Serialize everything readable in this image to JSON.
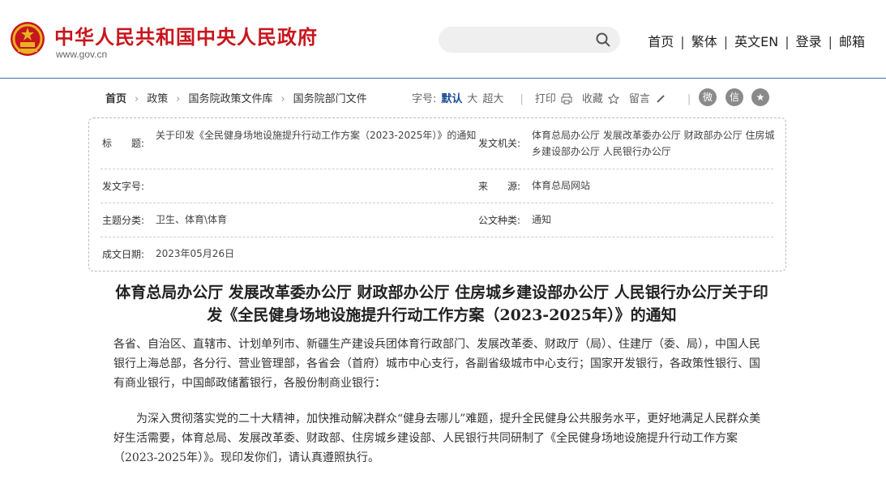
{
  "header": {
    "site_title": "中华人民共和国中央人民政府",
    "site_url": "www.gov.cn",
    "search_placeholder": "",
    "nav": [
      "首页",
      "繁体",
      "英文EN",
      "登录",
      "邮箱"
    ],
    "brand_color": "#c8161d"
  },
  "breadcrumb": [
    "首页",
    "政策",
    "国务院政策文件库",
    "国务院部门文件"
  ],
  "tools": {
    "font_label": "字号:",
    "font_sizes": [
      "默认",
      "大",
      "超大"
    ],
    "print": "打印",
    "favorite": "收藏",
    "comment": "留言",
    "share_icons": [
      "weibo-icon",
      "wechat-icon",
      "qzone-icon"
    ]
  },
  "meta": {
    "title_label": "标　　题:",
    "title_value": "关于印发《全民健身场地设施提升行动工作方案（2023-2025年）》的通知",
    "issuer_label": "发文机关:",
    "issuer_value": "体育总局办公厅 发展改革委办公厅 财政部办公厅 住房城乡建设部办公厅 人民银行办公厅",
    "docno_label": "发文字号:",
    "docno_value": "",
    "source_label": "来　　源:",
    "source_value": "体育总局网站",
    "category_label": "主题分类:",
    "category_value": "卫生、体育\\体育",
    "type_label": "公文种类:",
    "type_value": "通知",
    "date_label": "成文日期:",
    "date_value": "2023年05月26日"
  },
  "article": {
    "title": "体育总局办公厅 发展改革委办公厅 财政部办公厅 住房城乡建设部办公厅 人民银行办公厅关于印发《全民健身场地设施提升行动工作方案（2023-2025年）》的通知",
    "salutation": "各省、自治区、直辖市、计划单列市、新疆生产建设兵团体育行政部门、发展改革委、财政厅（局）、住建厅（委、局），中国人民银行上海总部，各分行、营业管理部，各省会（首府）城市中心支行，各副省级城市中心支行；国家开发银行，各政策性银行、国有商业银行，中国邮政储蓄银行，各股份制商业银行：",
    "body": "为深入贯彻落实党的二十大精神，加快推动解决群众“健身去哪儿”难题，提升全民健身公共服务水平，更好地满足人民群众美好生活需要，体育总局、发展改革委、财政部、住房城乡建设部、人民银行共同研制了《全民健身场地设施提升行动工作方案（2023-2025年）》。现印发你们，请认真遵照执行。"
  }
}
